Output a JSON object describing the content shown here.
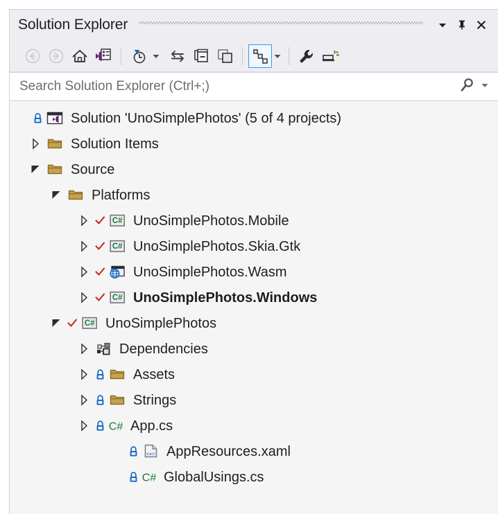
{
  "window": {
    "title": "Solution Explorer",
    "buttons": [
      {
        "name": "window-menu-dropdown",
        "icon": "chevron-down-icon",
        "label": "▾"
      },
      {
        "name": "auto-hide-pin-button",
        "icon": "pin-icon",
        "label": "Pin"
      },
      {
        "name": "close-button",
        "icon": "close-icon",
        "label": "Close"
      }
    ]
  },
  "toolbar": {
    "items": [
      {
        "name": "back-button",
        "icon": "back-arrow-icon",
        "tooltip": "Back",
        "enabled": false
      },
      {
        "name": "forward-button",
        "icon": "forward-arrow-icon",
        "tooltip": "Forward",
        "enabled": false
      },
      {
        "name": "home-button",
        "icon": "home-icon",
        "tooltip": "Home",
        "enabled": true
      },
      {
        "name": "properties-window-button",
        "icon": "vs-document-icon",
        "tooltip": "Properties Window",
        "enabled": true
      },
      {
        "name": "pending-changes-filter-button",
        "icon": "clock-filter-icon",
        "tooltip": "Pending Changes Filter",
        "enabled": true
      },
      {
        "name": "filter-dropdown-button",
        "icon": "chevron-down-icon",
        "tooltip": "Filter options",
        "enabled": true
      },
      {
        "name": "sync-with-active-document-button",
        "icon": "sync-arrows-icon",
        "tooltip": "Sync with Active Document",
        "enabled": true
      },
      {
        "name": "collapse-all-button",
        "icon": "collapse-all-icon",
        "tooltip": "Collapse All",
        "enabled": true
      },
      {
        "name": "show-all-files-button",
        "icon": "show-all-files-icon",
        "tooltip": "Show All Files",
        "enabled": true
      },
      {
        "name": "view-code-map-button",
        "icon": "code-map-icon",
        "tooltip": "View Code Map",
        "enabled": true,
        "active": true
      },
      {
        "name": "code-map-dropdown-button",
        "icon": "chevron-down-icon",
        "tooltip": "Code Map options",
        "enabled": true
      },
      {
        "name": "properties-button",
        "icon": "wrench-icon",
        "tooltip": "Properties",
        "enabled": true
      },
      {
        "name": "preview-selected-items-button",
        "icon": "preview-icon",
        "tooltip": "Preview Selected Items",
        "enabled": true
      }
    ]
  },
  "search": {
    "placeholder": "Search Solution Explorer (Ctrl+;)",
    "value": "",
    "icon": "search-magnifier-icon",
    "dropdown_icon": "chevron-down-icon"
  },
  "tree": {
    "rows": [
      {
        "name": "tree-item-solution",
        "label": "Solution 'UnoSimplePhotos' (5 of 4 projects)",
        "depth": 0,
        "twisty": "none",
        "lock": true,
        "check": false,
        "icon": "solution-icon",
        "bold": false
      },
      {
        "name": "tree-item-solution-items",
        "label": "Solution Items",
        "depth": 1,
        "twisty": "collapsed",
        "lock": false,
        "check": false,
        "icon": "folder-icon",
        "bold": false
      },
      {
        "name": "tree-item-source",
        "label": "Source",
        "depth": 1,
        "twisty": "expanded",
        "lock": false,
        "check": false,
        "icon": "folder-icon",
        "bold": false
      },
      {
        "name": "tree-item-platforms",
        "label": "Platforms",
        "depth": 2,
        "twisty": "expanded",
        "lock": false,
        "check": false,
        "icon": "folder-icon",
        "bold": false
      },
      {
        "name": "tree-item-unosimplephotos-mobile",
        "label": "UnoSimplePhotos.Mobile",
        "depth": 3,
        "twisty": "collapsed",
        "lock": false,
        "check": true,
        "icon": "csharp-project-icon",
        "bold": false
      },
      {
        "name": "tree-item-unosimplephotos-skia-gtk",
        "label": "UnoSimplePhotos.Skia.Gtk",
        "depth": 3,
        "twisty": "collapsed",
        "lock": false,
        "check": true,
        "icon": "csharp-project-icon",
        "bold": false
      },
      {
        "name": "tree-item-unosimplephotos-wasm",
        "label": "UnoSimplePhotos.Wasm",
        "depth": 3,
        "twisty": "collapsed",
        "lock": false,
        "check": true,
        "icon": "wasm-project-icon",
        "bold": false
      },
      {
        "name": "tree-item-unosimplephotos-windows",
        "label": "UnoSimplePhotos.Windows",
        "depth": 3,
        "twisty": "collapsed",
        "lock": false,
        "check": true,
        "icon": "csharp-project-icon",
        "bold": true
      },
      {
        "name": "tree-item-unosimplephotos",
        "label": "UnoSimplePhotos",
        "depth": 2,
        "twisty": "expanded",
        "lock": false,
        "check": true,
        "icon": "csharp-project-icon",
        "bold": false
      },
      {
        "name": "tree-item-dependencies",
        "label": "Dependencies",
        "depth": 3,
        "twisty": "collapsed",
        "lock": false,
        "check": false,
        "icon": "dependencies-icon",
        "bold": false
      },
      {
        "name": "tree-item-assets",
        "label": "Assets",
        "depth": 3,
        "twisty": "collapsed",
        "lock": true,
        "check": false,
        "icon": "folder-icon",
        "bold": false
      },
      {
        "name": "tree-item-strings",
        "label": "Strings",
        "depth": 3,
        "twisty": "collapsed",
        "lock": true,
        "check": false,
        "icon": "folder-icon",
        "bold": false
      },
      {
        "name": "tree-item-app-cs",
        "label": "App.cs",
        "depth": 3,
        "twisty": "collapsed",
        "lock": true,
        "check": false,
        "icon": "csharp-file-icon",
        "bold": false
      },
      {
        "name": "tree-item-appresources-xaml",
        "label": "AppResources.xaml",
        "depth": 4,
        "twisty": "none",
        "lock": true,
        "check": false,
        "icon": "xaml-file-icon",
        "bold": false
      },
      {
        "name": "tree-item-globalusings-cs",
        "label": "GlobalUsings.cs",
        "depth": 4,
        "twisty": "none",
        "lock": true,
        "check": false,
        "icon": "csharp-file-icon",
        "bold": false
      }
    ]
  },
  "colors": {
    "panel_background": "#f5f5f5",
    "chrome_background": "#eeeef2",
    "folder": "#c5a253",
    "folder_outline": "#8a6d1f",
    "csharp_green": "#1a7a33",
    "lock_blue": "#1569c7",
    "check_red": "#c42b1c",
    "accent_blue": "#2b9df4",
    "vs_purple": "#68217a",
    "wasm_blue": "#1569c7",
    "text": "#1e1e1e"
  },
  "icon_glyphs": {
    "csharp_label": "C#"
  }
}
